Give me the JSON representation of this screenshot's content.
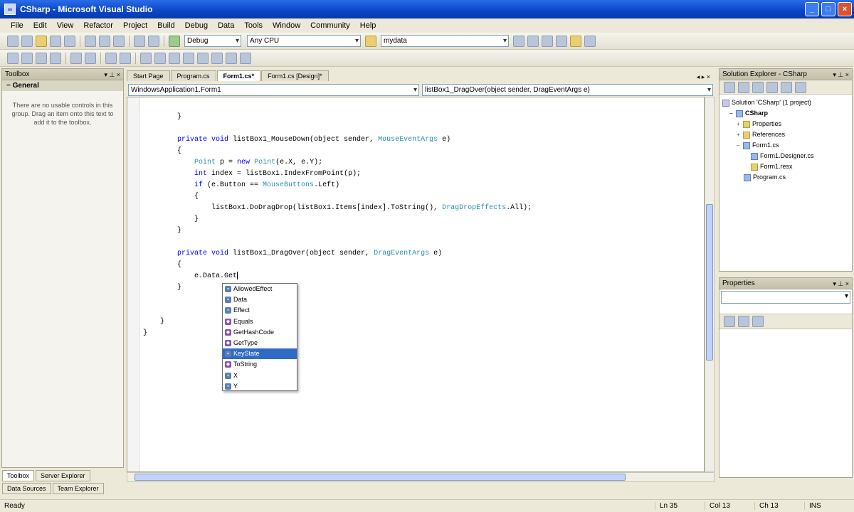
{
  "window": {
    "title": "CSharp - Microsoft Visual Studio"
  },
  "menu": [
    "File",
    "Edit",
    "View",
    "Refactor",
    "Project",
    "Build",
    "Debug",
    "Data",
    "Tools",
    "Window",
    "Community",
    "Help"
  ],
  "toolbar": {
    "config": "Debug",
    "platform": "Any CPU",
    "find": "mydata"
  },
  "toolbox": {
    "title": "Toolbox",
    "group": "General",
    "message": "There are no usable controls in this group. Drag an item onto this text to add it to the toolbox."
  },
  "bottom_tabs": [
    "Toolbox",
    "Server Explorer",
    "Data Sources",
    "Team Explorer"
  ],
  "doc_tabs": [
    "Start Page",
    "Program.cs",
    "Form1.cs*",
    "Form1.cs [Design]*"
  ],
  "nav": {
    "type": "WindowsApplication1.Form1",
    "member": "listBox1_DragOver(object sender, DragEventArgs e)"
  },
  "code": {
    "l1": "}",
    "l3_kw": "private void ",
    "l3_name": "listBox1_MouseDown(object sender, ",
    "l3_type": "MouseEventArgs",
    "l3_end": " e)",
    "l4": "{",
    "l5_type": "Point",
    "l5_mid": " p = ",
    "l5_kw": "new",
    "l5_type2": " Point",
    "l5_end": "(e.X, e.Y);",
    "l6_kw": "int",
    "l6_rest": " index = listBox1.IndexFromPoint(p);",
    "l7_kw": "if",
    "l7_mid": " (e.Button == ",
    "l7_type": "MouseButtons",
    "l7_end": ".Left)",
    "l8": "{",
    "l9_a": "listBox1.DoDragDrop(listBox1.Items[index].ToString(), ",
    "l9_type": "DragDropEffects",
    "l9_end": ".All);",
    "l10": "}",
    "l11": "}",
    "l13_kw": "private void ",
    "l13_name": "listBox1_DragOver(object sender, ",
    "l13_type": "DragEventArgs",
    "l13_end": " e)",
    "l14": "{",
    "l15": "e.Data.Get",
    "l16": "}",
    "l18": "}",
    "l19": "}"
  },
  "intellisense": [
    {
      "label": "AllowedEffect",
      "kind": "prop"
    },
    {
      "label": "Data",
      "kind": "prop"
    },
    {
      "label": "Effect",
      "kind": "prop"
    },
    {
      "label": "Equals",
      "kind": "meth"
    },
    {
      "label": "GetHashCode",
      "kind": "meth"
    },
    {
      "label": "GetType",
      "kind": "meth"
    },
    {
      "label": "KeyState",
      "kind": "prop",
      "selected": true
    },
    {
      "label": "ToString",
      "kind": "meth"
    },
    {
      "label": "X",
      "kind": "prop"
    },
    {
      "label": "Y",
      "kind": "prop"
    }
  ],
  "solution_explorer": {
    "title": "Solution Explorer - CSharp",
    "nodes": [
      "Solution 'CSharp' (1 project)",
      "CSharp",
      "Properties",
      "References",
      "Form1.cs",
      "Form1.Designer.cs",
      "Form1.resx",
      "Program.cs"
    ]
  },
  "properties": {
    "title": "Properties"
  },
  "status": {
    "ready": "Ready",
    "ln": "Ln 35",
    "col": "Col 13",
    "ch": "Ch 13",
    "mode": "INS"
  }
}
